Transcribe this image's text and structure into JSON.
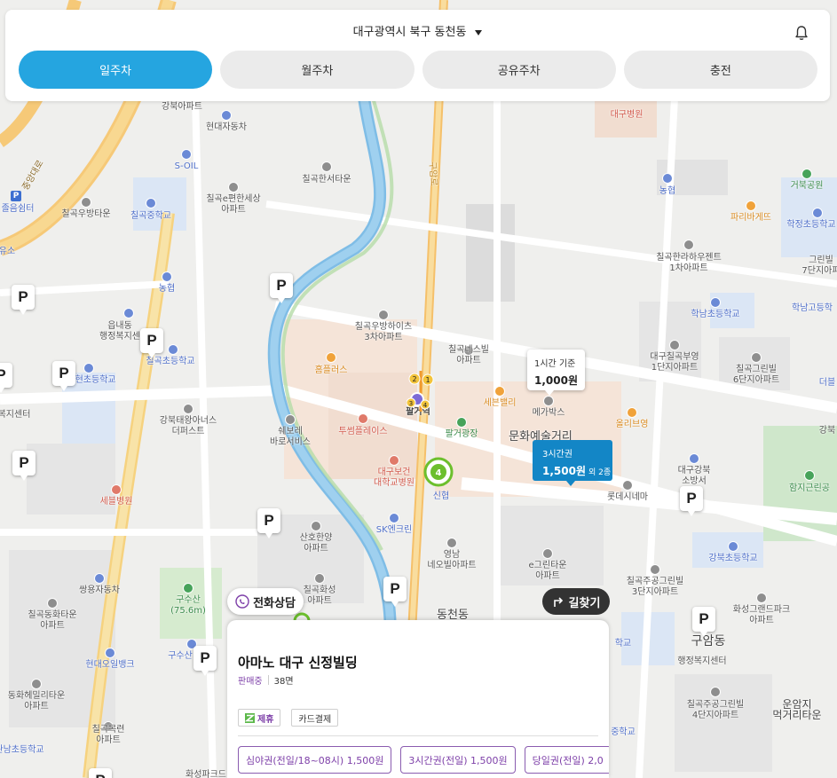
{
  "header": {
    "location": "대구광역시 북구 동천동",
    "tabs": [
      {
        "label": "일주차",
        "active": true
      },
      {
        "label": "월주차",
        "active": false
      },
      {
        "label": "공유주차",
        "active": false
      },
      {
        "label": "충전",
        "active": false
      }
    ]
  },
  "colors": {
    "accent": "#25a5e0",
    "partner": "#7d3fa8",
    "bubble_blue": "#1386c6"
  },
  "icons": {
    "bell": "bell-icon",
    "caret": "caret-down-icon",
    "phone": "phone-icon",
    "route": "route-arrow-icon",
    "parking": "parking-pin-icon"
  },
  "map": {
    "labels": {
      "gangbuk_apt": "강북아파트",
      "hyundai_car": "현대자동차",
      "soil": "S-OIL",
      "chilgok_hanseo": "칠곡한서타운",
      "chilgok_epyeon_1": "칠곡e편한세상",
      "chilgok_epyeon_2": "아파트",
      "chilgok_middle": "칠곡중학교",
      "chilgok_woobang": "칠곡우방타운",
      "nonghyup_1": "농협",
      "eupnae_1": "읍내동",
      "eupnae_2": "행정복지센",
      "chilgok_elem": "칠곡초등학교",
      "bokhyun": "복현초등학교",
      "welfare": "복지센터",
      "gangbuk_taewang_1": "강북태왕아너스",
      "gangbuk_taewang_2": "더퍼스트",
      "homeplus": "홈플러스",
      "tu_som": "투썸플레이스",
      "hanseoheights_1": "칠곡우방하이츠",
      "hanseoheights_2": "3차아파트",
      "paljeoe_station": "팔거역",
      "sebeullan": "세븐밸리",
      "mega": "메가박스",
      "palgeo_sq": "팔거광장",
      "olive": "올리브영",
      "culture_street": "문화예술거리",
      "chilgok_nesvil_1": "칠곡네스빌",
      "chilgok_nesvil_2": "아파트",
      "daegu_bogeon_1": "대구보건",
      "daegu_bogeon_2": "대학교병원",
      "shinhyup": "신협",
      "sk_enclean": "SK엔크린",
      "lottecinema": "롯데시네마",
      "gangbuk_fire_1": "대구강북",
      "gangbuk_fire_2": "소방서",
      "chilgok_buyoung_1": "대구칠곡부영",
      "chilgok_buyoung_2": "1단지아파트",
      "chilgok_green_1": "칠곡그린빌",
      "chilgok_green_2": "6단지아파트",
      "chilgok_hanra_1": "칠곡한라하우젠트",
      "chilgok_hanra_2": "1차아파트",
      "haknam": "학남초등학교",
      "hakjeong": "학정초등학교",
      "geobuk": "거북공원",
      "paris": "파리바게뜨",
      "nonghyup_2": "농협",
      "daegu_hospital": "대구병원",
      "sevel": "세블병원",
      "sanho_1": "산호한양",
      "sanho_2": "아파트",
      "chilgok_hwa_1": "칠곡화성",
      "chilgok_hwa_2": "아파트",
      "yeongnam_1": "영남",
      "yeongnam_2": "네오빌아파트",
      "egreen_1": "e그린타운",
      "egreen_2": "아파트",
      "juisgreen_1": "칠곡주공그린빌",
      "juisgreen_2": "3단지아파트",
      "gangbuk_elem": "강북초등학교",
      "hwaseong_1": "화성그랜드파크",
      "hwaseong_2": "아파트",
      "gusu_mt_1": "구수산",
      "gusu_mt_2": "(75.6m)",
      "ssangyong": "쌍용자동차",
      "chilgok_hwata_1": "칠곡동화타운",
      "chilgok_hwata_2": "아파트",
      "hyundai_oil": "현대오일뱅크",
      "gusu_park": "구수산",
      "dongbyeon_1": "동화헤밀리타운",
      "dongbyeon_2": "아파트",
      "chilgok_mokryeon_1": "칠곡목련",
      "chilgok_mokryeon_2": "아파트",
      "guam_1": "구암동",
      "guam_2": "행정복지센터",
      "juisgreen4_1": "칠곡주공그린빌",
      "juisgreen4_2": "4단지아파트",
      "unamji_1": "운암지",
      "unamji_2": "먹거리타운",
      "hamji_park": "함지근린공",
      "dongcheon": "동천동",
      "school_left": "관남초등학교",
      "road_label": "중앙대로",
      "parking_left": "졸음쉼터",
      "s_yu": "유소",
      "hwaseongpark_bottom": "화성파크드",
      "grand_1": "그린빌",
      "grand_2": "7단지아파",
      "haknam_high": "학남고등학",
      "deo": "더블",
      "gangbuk_r": "강북",
      "sangjeo": "중학교",
      "hakgyo_r": "학교",
      "road_2": "구암로"
    },
    "station_lines": [
      "2",
      "1",
      "3",
      "4"
    ],
    "cluster_count": "4"
  },
  "bubbles": [
    {
      "time": "1시간 기준",
      "price": "1,000원"
    },
    {
      "time": "3시간권",
      "price": "1,500원",
      "extra": "외 2종"
    }
  ],
  "buttons": {
    "phone": "전화상담",
    "route": "길찾기"
  },
  "card": {
    "title": "아마노 대구 신정빌딩",
    "status": "판매중",
    "count": "38면",
    "badges": [
      "제휴",
      "카드결제"
    ],
    "tickets": [
      "심야권(전일/18~08시) 1,500원",
      "3시간권(전일) 1,500원",
      "당일권(전일) 2,0"
    ]
  }
}
